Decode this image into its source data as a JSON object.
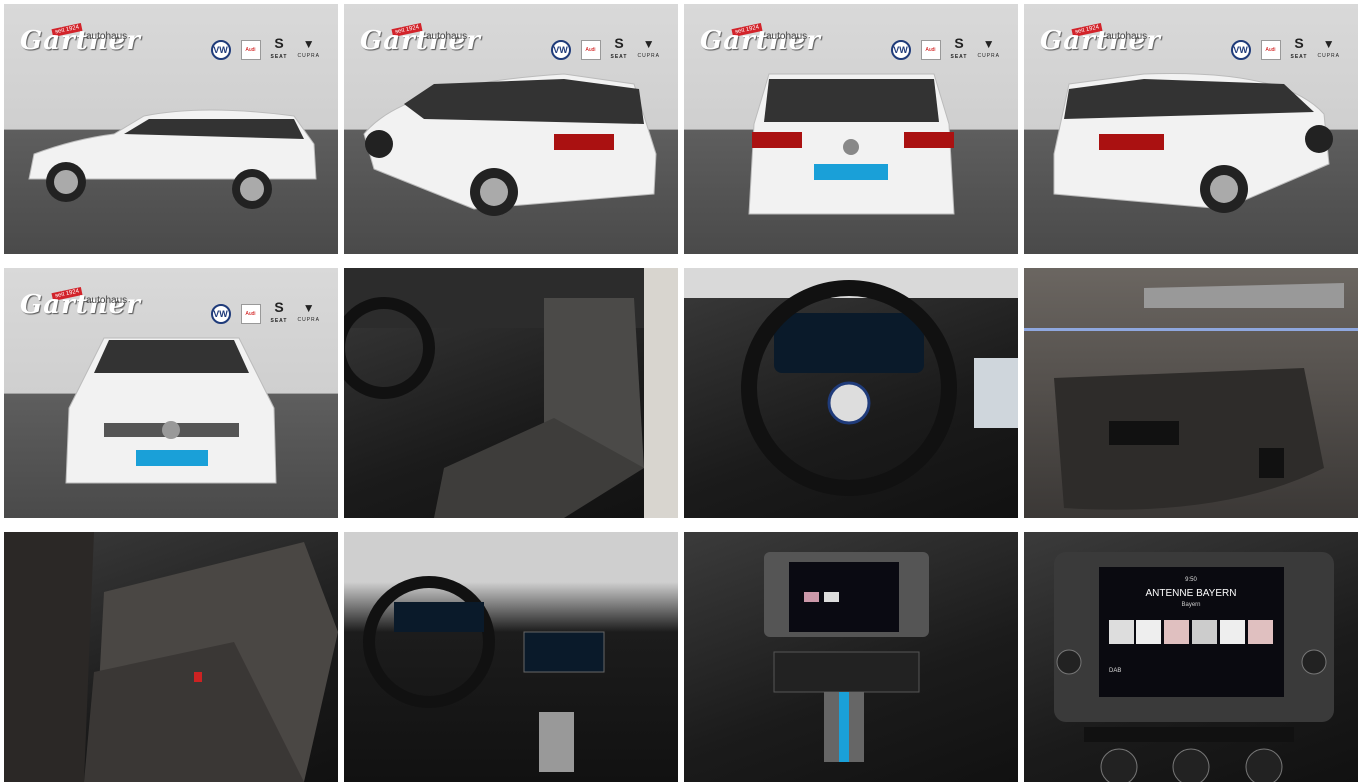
{
  "dealer": {
    "name": "Gartner",
    "prefix": "autohaus",
    "tag": "seit 1924",
    "brands": [
      "VW",
      "Audi",
      "SEAT",
      "CUPRA"
    ],
    "brand_labels": {
      "seat": "SEAT",
      "cupra": "CUPRA"
    }
  },
  "gallery": [
    {
      "id": 1,
      "alt": "Exterior side view"
    },
    {
      "id": 2,
      "alt": "Exterior rear three-quarter left"
    },
    {
      "id": 3,
      "alt": "Exterior rear view"
    },
    {
      "id": 4,
      "alt": "Exterior rear three-quarter right"
    },
    {
      "id": 5,
      "alt": "Exterior front view"
    },
    {
      "id": 6,
      "alt": "Front seats"
    },
    {
      "id": 7,
      "alt": "Steering wheel and digital cockpit"
    },
    {
      "id": 8,
      "alt": "Door panel"
    },
    {
      "id": 9,
      "alt": "Rear seats"
    },
    {
      "id": 10,
      "alt": "Dashboard overview"
    },
    {
      "id": 11,
      "alt": "Center console"
    },
    {
      "id": 12,
      "alt": "Infotainment radio screen"
    }
  ],
  "infotainment": {
    "station": "ANTENNE BAYERN",
    "region": "Bayern",
    "time": "9:50",
    "band": "DAB"
  },
  "colors": {
    "car_white": "#f2f2f2",
    "showroom_wall": "#d4d4d4",
    "showroom_floor": "#505050",
    "brand_red": "#d2232a",
    "vw_blue": "#1f3b7a",
    "plate_blue": "#1aa0d8"
  }
}
